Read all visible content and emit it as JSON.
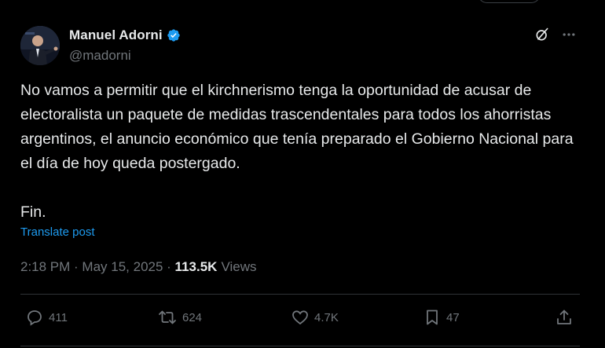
{
  "author": {
    "display_name": "Manuel Adorni",
    "handle": "@madorni",
    "verified": true
  },
  "tweet": {
    "text": "No vamos a permitir que el kirchnerismo tenga la oportunidad de acusar de electoralista un paquete de medidas trascendentales para todos los ahorristas argentinos, el anuncio económico que tenía preparado el Gobierno Nacional para el día de hoy queda postergado.\n\nFin.",
    "translate_label": "Translate post"
  },
  "meta": {
    "time": "2:18 PM",
    "dot1": " · ",
    "date": "May 15, 2025",
    "dot2": " · ",
    "views_count": "113.5K",
    "views_label": "Views"
  },
  "actions": {
    "replies": "411",
    "reposts": "624",
    "likes": "4.7K",
    "bookmarks": "47"
  },
  "icons": {
    "verified": "verified-badge-icon",
    "grok": "grok-icon",
    "more": "more-icon",
    "reply": "reply-icon",
    "repost": "repost-icon",
    "like": "heart-icon",
    "bookmark": "bookmark-icon",
    "share": "share-icon"
  },
  "colors": {
    "background": "#000000",
    "text": "#e7e9ea",
    "muted": "#71767b",
    "accent": "#1d9bf0",
    "divider": "#2f3336"
  }
}
